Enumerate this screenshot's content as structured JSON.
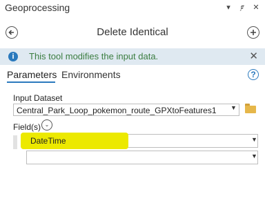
{
  "window": {
    "title": "Geoprocessing",
    "controls": [
      "▾",
      "𝟋",
      "✕"
    ]
  },
  "tool": {
    "title": "Delete Identical",
    "back_icon": "←",
    "add_icon": "+"
  },
  "info_banner": {
    "icon": "i",
    "text": "This tool modifies the input data.",
    "close": "✕"
  },
  "tabs": [
    {
      "label": "Parameters",
      "active": true
    },
    {
      "label": "Environments",
      "active": false
    }
  ],
  "help_icon": "?",
  "input_dataset": {
    "label": "Input Dataset",
    "value": "Central_Park_Loop_pokemon_route_GPXtoFeatures1"
  },
  "fields": {
    "label": "Field(s)",
    "rows": [
      {
        "value": "DateTime",
        "highlighted": true
      },
      {
        "value": "",
        "highlighted": false
      }
    ]
  },
  "colors": {
    "accent": "#2a79bd",
    "info_bg": "#dfe9f1",
    "info_text": "#3b7d40",
    "highlight": "#ece900"
  }
}
